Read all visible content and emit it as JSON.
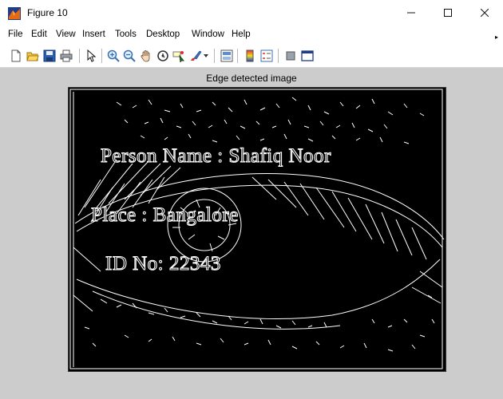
{
  "window": {
    "title": "Figure 10",
    "controls": {
      "minimize": "—",
      "maximize": "☐",
      "close": "✕"
    }
  },
  "menu": [
    "File",
    "Edit",
    "View",
    "Insert",
    "Tools",
    "Desktop",
    "Window",
    "Help"
  ],
  "toolbar": {
    "icons": [
      "new-figure-icon",
      "open-file-icon",
      "save-icon",
      "print-icon",
      "pointer-icon",
      "zoom-in-icon",
      "zoom-out-icon",
      "pan-hand-icon",
      "rotate-3d-icon",
      "data-cursor-icon",
      "brush-icon",
      "link-plot-icon",
      "colorbar-icon",
      "legend-icon",
      "hide-plot-tools-icon",
      "show-plot-tools-icon"
    ]
  },
  "figure": {
    "axes_title": "Edge detected image",
    "overlay_lines": [
      "Person Name : Shafiq Noor",
      "Place : Bangalore",
      "ID No: 22343"
    ]
  },
  "colors": {
    "figure_bg": "#cccccc",
    "image_bg": "#000000",
    "edges": "#ffffff"
  }
}
